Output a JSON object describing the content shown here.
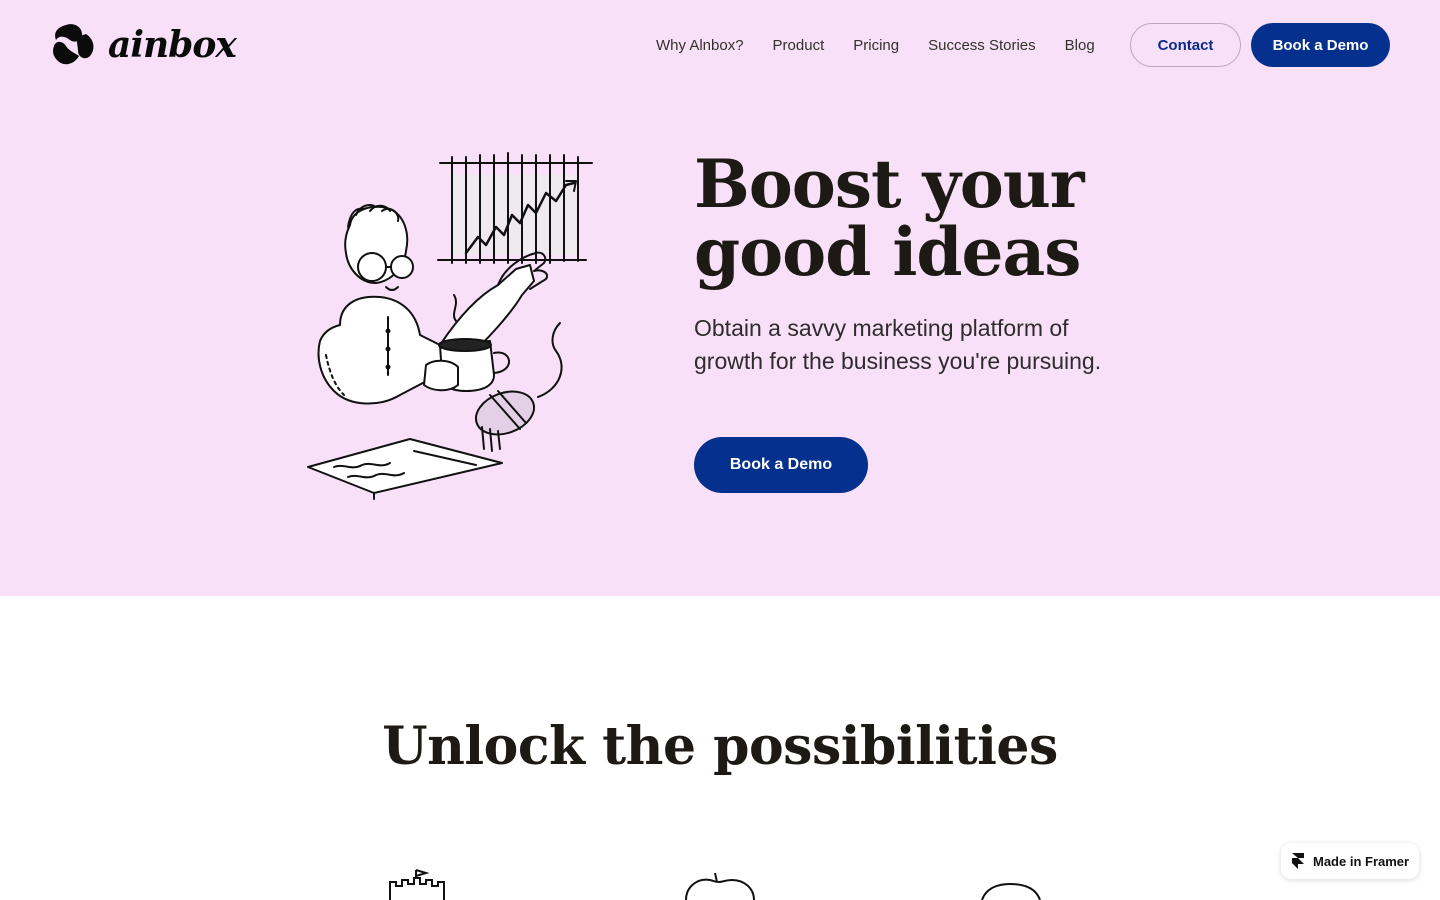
{
  "brand": {
    "name": "ainbox"
  },
  "nav": {
    "items": [
      {
        "label": "Why Alnbox?"
      },
      {
        "label": "Product"
      },
      {
        "label": "Pricing"
      },
      {
        "label": "Success Stories"
      },
      {
        "label": "Blog"
      }
    ],
    "contact_label": "Contact",
    "demo_label": "Book a Demo"
  },
  "hero": {
    "title": "Boost your good ideas",
    "subtitle": "Obtain a savvy marketing platform of growth for the business you're pursuing.",
    "cta_label": "Book a Demo",
    "illustration": "man-with-coffee-and-growth-chart-illustration"
  },
  "features": {
    "title": "Unlock the possibilities",
    "icons": [
      "castle-icon",
      "apple-icon",
      "dome-icon"
    ]
  },
  "badge": {
    "label": "Made in Framer",
    "icon": "framer-icon"
  },
  "colors": {
    "hero_bg": "#f8e1f8",
    "primary": "#05308e",
    "text": "#1d1a16"
  }
}
